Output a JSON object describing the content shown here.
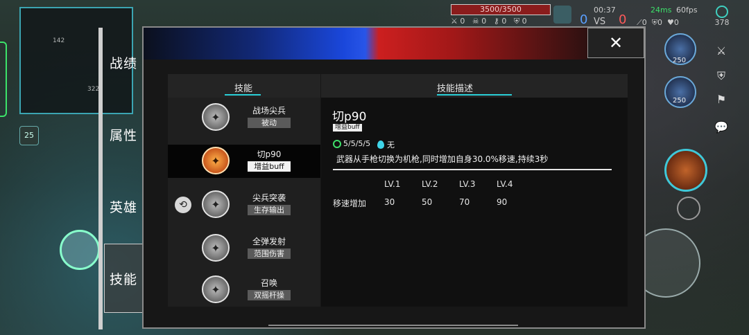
{
  "hud": {
    "hp": "3500/3500",
    "time": "00:37",
    "ping": "24ms",
    "fps": "60fps",
    "score_blue": "0",
    "score_red": "0",
    "vs": "VS",
    "kills_blue": "0",
    "deaths_blue": "0",
    "assists_blue": "0",
    "extra_blue": "0",
    "stat_a": "0",
    "stat_b": "0",
    "stat_c": "0",
    "coins": "378",
    "portrait1_value": "250",
    "portrait2_value": "250",
    "level": "25",
    "minimap_a": "142",
    "minimap_b": "322"
  },
  "tabs": [
    {
      "label": "战绩"
    },
    {
      "label": "属性"
    },
    {
      "label": "英雄"
    },
    {
      "label": "技能"
    }
  ],
  "panel": {
    "close_label": "✕",
    "list_header": "技能",
    "desc_header": "技能描述"
  },
  "skills": [
    {
      "name": "战场尖兵",
      "tag": "被动"
    },
    {
      "name": "切p90",
      "tag": "增益buff"
    },
    {
      "name": "尖兵突袭",
      "tag": "生存输出"
    },
    {
      "name": "全弹发射",
      "tag": "范围伤害"
    },
    {
      "name": "召唤",
      "tag": "双摇杆操"
    }
  ],
  "detail": {
    "title": "切p90",
    "badge": "增益buff",
    "cooldown": "5/5/5/5",
    "cost": "无",
    "description": "武器从手枪切换为机枪,同时增加自身30.0%移速,持续3秒",
    "levels": [
      "LV.1",
      "LV.2",
      "LV.3",
      "LV.4"
    ],
    "row_label": "移速增加",
    "row_values": [
      "30",
      "50",
      "70",
      "90"
    ]
  },
  "colors": {
    "accent": "#2ad0d8",
    "blue_team": "#2a5cff",
    "red_team": "#e02020"
  }
}
